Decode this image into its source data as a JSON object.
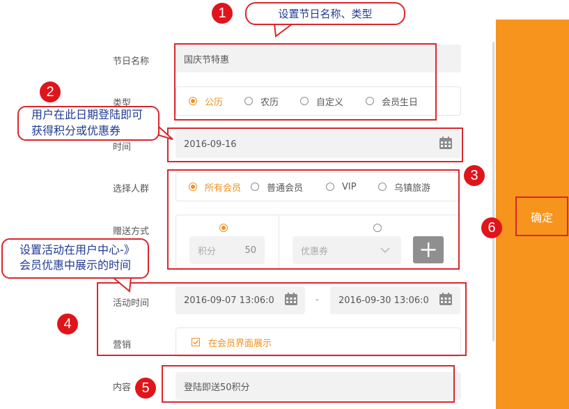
{
  "callouts": {
    "c1": "设置节日名称、类型",
    "c2_line1": "用户在此日期登陆即可",
    "c2_line2": "获得积分或优惠券",
    "c4_line1": "设置活动在用户中心-》",
    "c4_line2": "会员优惠中展示的时间"
  },
  "badges": [
    "1",
    "2",
    "3",
    "4",
    "5",
    "6"
  ],
  "form": {
    "name_label": "节日名称",
    "name_value": "国庆节特惠",
    "type_label": "类型",
    "type_options": [
      "公历",
      "农历",
      "自定义",
      "会员生日"
    ],
    "type_selected": "公历",
    "time_label": "时间",
    "time_value": "2016-09-16",
    "crowd_label": "选择人群",
    "crowd_options": [
      "所有会员",
      "普通会员",
      "VIP",
      "乌镇旅游"
    ],
    "crowd_selected": "所有会员",
    "gift_label": "赠送方式",
    "points_label": "积分",
    "points_value": "50",
    "coupon_placeholder": "优惠券",
    "activity_label": "活动时间",
    "activity_start": "2016-09-07 13:06:0",
    "activity_sep": "-",
    "activity_end": "2016-09-30 13:06:0",
    "marketing_label": "营销",
    "marketing_option": "在会员界面展示",
    "content_label": "内容",
    "content_value": "登陆即送50积分"
  },
  "side": {
    "confirm_label": "确定",
    "panel_color": "#f7941d"
  },
  "colors": {
    "accent": "#f0901e",
    "annotation_red": "#d9262c",
    "callout_text": "#1f3a93"
  },
  "icons": [
    "calendar-icon",
    "chevron-down-icon",
    "plus-icon",
    "checkbox-checked-icon"
  ]
}
